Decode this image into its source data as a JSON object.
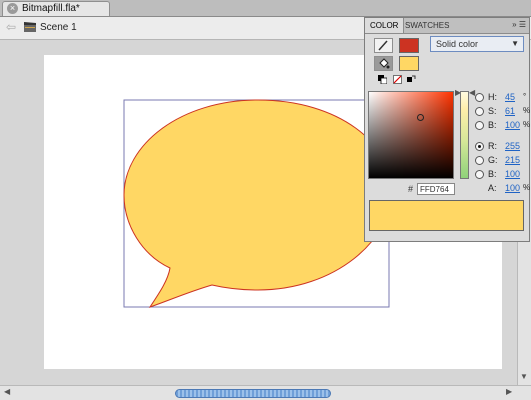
{
  "document": {
    "tab_title": "Bitmapfill.fla*"
  },
  "scene": {
    "label": "Scene 1"
  },
  "colors": {
    "stroke": "#CC3322",
    "fill": "#FFD764"
  },
  "color_panel": {
    "tabs": [
      "COLOR",
      "SWATCHES"
    ],
    "menu_icon": "»  ☰",
    "fill_type": "Solid color",
    "hsb": [
      {
        "label": "H:",
        "value": "45",
        "unit": "°"
      },
      {
        "label": "S:",
        "value": "61",
        "unit": "%"
      },
      {
        "label": "B:",
        "value": "100",
        "unit": "%"
      }
    ],
    "rgb": [
      {
        "label": "R:",
        "value": "255"
      },
      {
        "label": "G:",
        "value": "215"
      },
      {
        "label": "B:",
        "value": "100"
      }
    ],
    "alpha": {
      "label": "A:",
      "value": "100",
      "unit": "%"
    },
    "hex_hash": "#",
    "hex": "FFD764",
    "picker_saturation": 0.61,
    "picker_brightness": 1.0
  },
  "icons": {
    "close": "close-icon",
    "scene": "clapperboard-icon",
    "stroke_tool": "pencil-icon",
    "fill_tool": "paint-bucket-icon",
    "black_white": "black-white-icon",
    "no_color": "no-color-icon",
    "swap": "swap-colors-icon"
  }
}
